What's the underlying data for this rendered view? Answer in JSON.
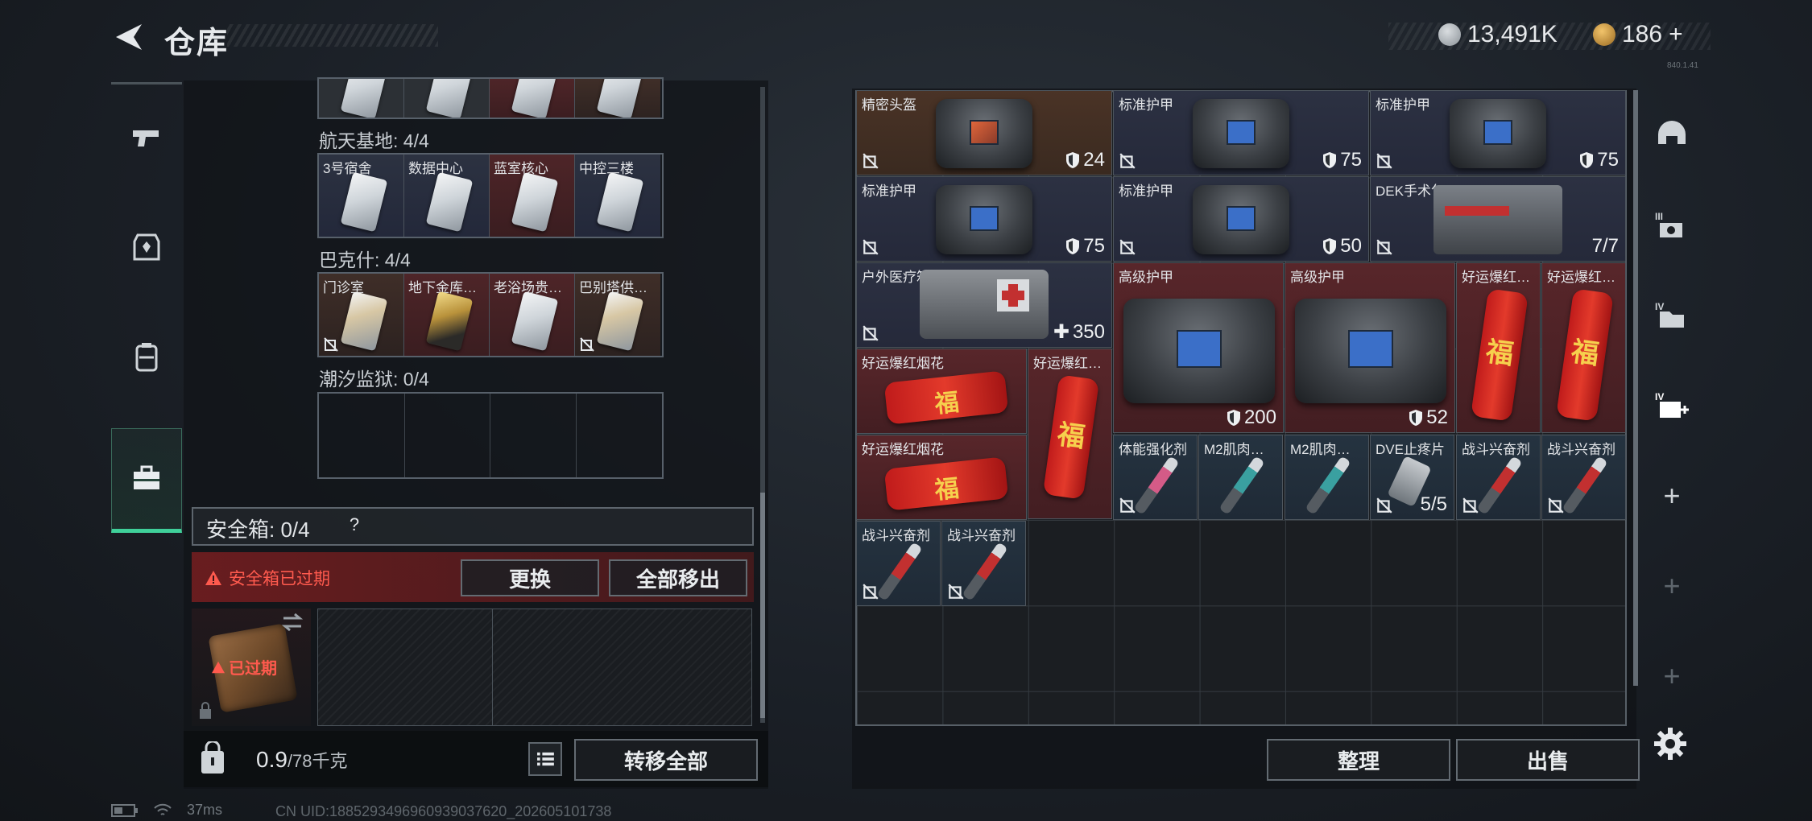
{
  "header": {
    "title": "仓库",
    "currency_silver": "13,491K",
    "currency_gold": "186",
    "gold_add": "+",
    "version": "840.1.41"
  },
  "left_nav": {
    "items": [
      "pistol-icon",
      "armor-vest-icon",
      "backpack-icon",
      "toolbox-icon"
    ],
    "active_index": 3
  },
  "keycards": {
    "group1": {
      "label": "航天基地: 4/4",
      "cards": [
        {
          "name": "3号宿舍",
          "bg": "blue"
        },
        {
          "name": "数据中心",
          "bg": "blue"
        },
        {
          "name": "蓝室核心",
          "bg": "red"
        },
        {
          "name": "中控三楼",
          "bg": "blue"
        }
      ]
    },
    "group2": {
      "label": "巴克什: 4/4",
      "cards": [
        {
          "name": "门诊室",
          "bg": "brown"
        },
        {
          "name": "地下金库…",
          "bg": "red"
        },
        {
          "name": "老浴场贵…",
          "bg": "red"
        },
        {
          "name": "巴别塔供…",
          "bg": "brown"
        }
      ]
    },
    "group3": {
      "label": "潮汐监狱: 0/4"
    }
  },
  "safe_box": {
    "label": "安全箱: 0/4",
    "help": "?",
    "warning": "安全箱已过期",
    "replace_button": "更换",
    "move_all_button": "全部移出",
    "expired_tag": "已过期"
  },
  "backpack": {
    "weight_current": "0.9",
    "weight_max": "/78千克",
    "transfer_all_button": "转移全部"
  },
  "inventory": {
    "items": [
      {
        "name": "精密头盔",
        "value": "24",
        "type": "shield"
      },
      {
        "name": "标准护甲",
        "value": "75",
        "type": "shield"
      },
      {
        "name": "标准护甲",
        "value": "75",
        "type": "shield"
      },
      {
        "name": "标准护甲",
        "value": "75",
        "type": "shield"
      },
      {
        "name": "标准护甲",
        "value": "50",
        "type": "shield"
      },
      {
        "name": "DEK手术包",
        "value": "7/7",
        "type": "count"
      },
      {
        "name": "户外医疗箱",
        "value": "350",
        "type": "heal"
      },
      {
        "name": "高级护甲",
        "value": "200",
        "type": "shield"
      },
      {
        "name": "高级护甲",
        "value": "52",
        "type": "shield"
      },
      {
        "name": "好运爆红…",
        "value": "",
        "type": "none"
      },
      {
        "name": "好运爆红…",
        "value": "",
        "type": "none"
      },
      {
        "name": "好运爆红烟花",
        "value": "",
        "type": "none"
      },
      {
        "name": "好运爆红…",
        "value": "",
        "type": "none"
      },
      {
        "name": "好运爆红烟花",
        "value": "",
        "type": "none"
      },
      {
        "name": "体能强化剂",
        "value": "",
        "type": "none"
      },
      {
        "name": "M2肌肉…",
        "value": "",
        "type": "none"
      },
      {
        "name": "M2肌肉…",
        "value": "",
        "type": "none"
      },
      {
        "name": "DVE止疼片",
        "value": "5/5",
        "type": "count"
      },
      {
        "name": "战斗兴奋剂",
        "value": "",
        "type": "none"
      },
      {
        "name": "战斗兴奋剂",
        "value": "",
        "type": "none"
      },
      {
        "name": "战斗兴奋剂",
        "value": "",
        "type": "none"
      },
      {
        "name": "战斗兴奋剂",
        "value": "",
        "type": "none"
      }
    ],
    "firework_glyph": "福",
    "sort_button": "整理",
    "sell_button": "出售"
  },
  "right_nav": {
    "items": [
      "helmet-icon",
      "stash-tab-3-icon",
      "stash-tab-4-icon",
      "stash-tab-4-plus-icon",
      "+",
      "+",
      "+"
    ],
    "settings": "gear-icon"
  },
  "status_bar": {
    "ping": "37ms",
    "uid": "CN UID:1885293496960939037620_202605101738"
  }
}
